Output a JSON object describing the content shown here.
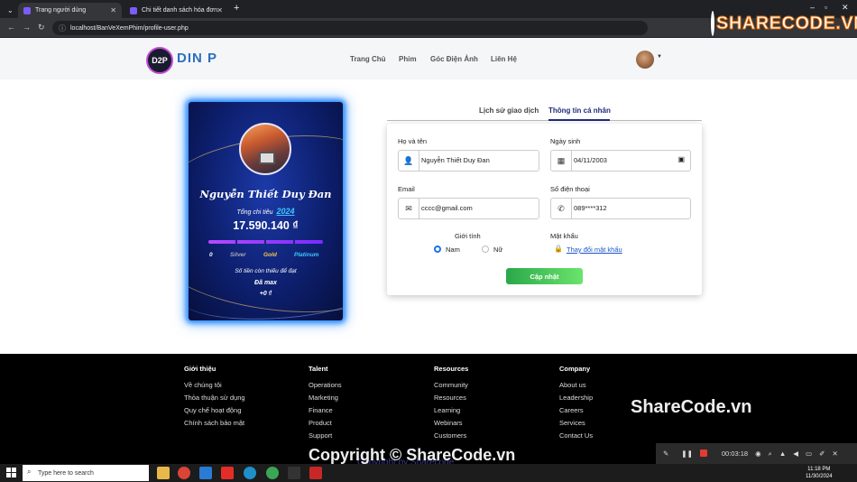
{
  "browser": {
    "tabs": [
      {
        "title": "Trang người dùng",
        "active": true
      },
      {
        "title": "Chi tiết danh sách hóa đơn",
        "active": false
      }
    ],
    "url": "localhost/BanVeXemPhim/profile-user.php"
  },
  "watermark": {
    "top_logo_text": "SHARECODE.VN",
    "middle_text": "ShareCode.vn",
    "footer_text": "Copyright © ShareCode.vn"
  },
  "site": {
    "logo_text": "D2P",
    "brand_text": "DIN P",
    "menu": [
      "Trang Chủ",
      "Phim",
      "Góc Điện Ảnh",
      "Liên Hệ"
    ]
  },
  "vip_card": {
    "name": "Nguyễn Thiết Duy Đan",
    "spend_label": "Tổng chi tiêu",
    "year": "2024",
    "total": "17.590.140 ₫",
    "progress": 1.0,
    "ranks": [
      {
        "label": "0",
        "color": "#ffffff"
      },
      {
        "label": "Silver",
        "color": "#a8a8b8"
      },
      {
        "label": "Gold",
        "color": "#f5c84a"
      },
      {
        "label": "Platinum",
        "color": "#3ec8ff"
      }
    ],
    "remaining_label": "Số tiền còn thiếu để đạt",
    "max_label": "Đã max",
    "remaining_value": "+0 ₫"
  },
  "profile_tabs": [
    {
      "label": "Lịch sử giao dịch",
      "active": false
    },
    {
      "label": "Thông tin cá nhân",
      "active": true
    }
  ],
  "form": {
    "fullname_label": "Họ và tên",
    "fullname_value": "Nguyễn Thiết Duy Đan",
    "dob_label": "Ngày sinh",
    "dob_value": "04/11/2003",
    "email_label": "Email",
    "email_value": "cccc@gmail.com",
    "phone_label": "Số điện thoại",
    "phone_value": "089****312",
    "gender_label": "Giới tính",
    "gender_options": [
      "Nam",
      "Nữ"
    ],
    "gender_selected": "Nam",
    "password_label": "Mật khẩu",
    "password_link": "Thay đổi mật khẩu",
    "submit_label": "Cập nhật"
  },
  "footer": {
    "columns": [
      {
        "title": "Giới thiệu",
        "items": [
          "Về chúng tôi",
          "Thỏa thuận sử dụng",
          "Quy chế hoạt động",
          "Chính sách bảo mật"
        ]
      },
      {
        "title": "Talent",
        "items": [
          "Operations",
          "Marketing",
          "Finance",
          "Product",
          "Support"
        ]
      },
      {
        "title": "Resources",
        "items": [
          "Community",
          "Resources",
          "Learning",
          "Webinars",
          "Customers"
        ]
      },
      {
        "title": "Company",
        "items": [
          "About us",
          "Leadership",
          "Careers",
          "Services",
          "Contact Us"
        ]
      }
    ],
    "copyright_text": "Copyright by Sharecode"
  },
  "recorder": {
    "time": "00:03:18"
  },
  "taskbar": {
    "search_placeholder": "Type here to search",
    "time": "11:18 PM",
    "date": "11/30/2024"
  }
}
